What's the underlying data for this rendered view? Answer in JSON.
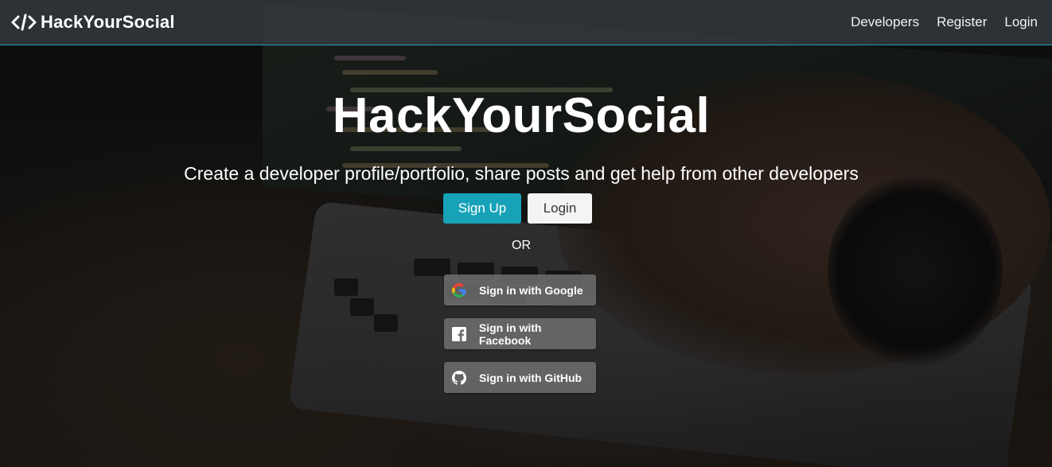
{
  "navbar": {
    "brand": "HackYourSocial",
    "links": [
      "Developers",
      "Register",
      "Login"
    ]
  },
  "hero": {
    "title": "HackYourSocial",
    "subtitle": "Create a developer profile/portfolio, share posts and get help from other developers",
    "signup_label": "Sign Up",
    "login_label": "Login",
    "or_label": "OR"
  },
  "social": {
    "google": "Sign in with Google",
    "facebook": "Sign in with Facebook",
    "github": "Sign in with GitHub"
  },
  "colors": {
    "accent": "#17a2b8",
    "navbar": "#343a40",
    "social_button": "#6e6e6e"
  },
  "icons": {
    "brand": "code-icon",
    "google": "google-icon",
    "facebook": "facebook-icon",
    "github": "github-icon"
  }
}
